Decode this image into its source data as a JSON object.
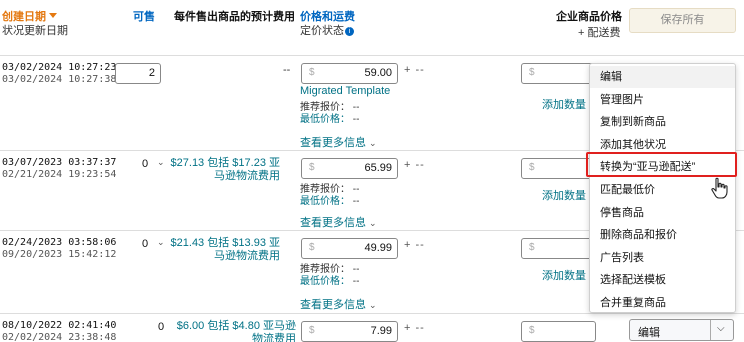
{
  "header": {
    "created_date": "创建日期",
    "status_updated_date": "状况更新日期",
    "available": "可售",
    "fee_per_item": "每件售出商品的预计费用",
    "price_and_shipping": "价格和运费",
    "pricing_status": "定价状态",
    "business_price": "企业商品价格",
    "plus_shipping": "+ 配送费",
    "save_all": "保存所有"
  },
  "currency_symbol": "$",
  "rows": [
    {
      "created": "03/02/2024 10:27:23",
      "updated": "03/02/2024 10:27:38",
      "quantity": "2",
      "fee": "--",
      "price": "59.00",
      "plus": "+ --",
      "template": "Migrated Template",
      "recommended_label": "推荐报价：",
      "recommended_value": "--",
      "lowest_label": "最低价格：",
      "lowest_value": "--",
      "more_info": "查看更多信息",
      "add_qty": "添加数量"
    },
    {
      "created": "03/07/2023 03:37:37",
      "updated": "02/21/2024 19:23:54",
      "quantity": "0",
      "fee_line1": "$27.13 包括 $17.23 亚",
      "fee_line2": "马逊物流费用",
      "dash": "--",
      "price": "65.99",
      "plus": "+ --",
      "recommended_label": "推荐报价：",
      "recommended_value": "--",
      "lowest_label": "最低价格：",
      "lowest_value": "--",
      "more_info": "查看更多信息",
      "add_qty": "添加数量"
    },
    {
      "created": "02/24/2023 03:58:06",
      "updated": "09/20/2023 15:42:12",
      "quantity": "0",
      "fee_line1": "$21.43 包括 $13.93 亚",
      "fee_line2": "马逊物流费用",
      "dash": "--",
      "price": "49.99",
      "plus": "+ --",
      "recommended_label": "推荐报价：",
      "recommended_value": "--",
      "lowest_label": "最低价格：",
      "lowest_value": "--",
      "more_info": "查看更多信息",
      "add_qty": "添加数量"
    },
    {
      "created": "08/10/2022 02:41:40",
      "updated": "02/02/2024 23:38:48",
      "quantity": "0",
      "fee_line1": "$6.00 包括 $4.80 亚马逊",
      "fee_line2": "物流费用",
      "price": "7.99",
      "plus": "+ --",
      "edit": "编辑"
    }
  ],
  "menu": {
    "items": [
      "编辑",
      "管理图片",
      "复制到新商品",
      "添加其他状况",
      "转换为“亚马逊配送”",
      "匹配最低价",
      "停售商品",
      "删除商品和报价",
      "广告列表",
      "选择配送模板",
      "合并重复商品"
    ],
    "highlighted_index": 4,
    "highlight_color": "#e0201e"
  },
  "colors": {
    "link": "#007185",
    "header_link": "#0066c0",
    "sort_active": "#e47911"
  }
}
